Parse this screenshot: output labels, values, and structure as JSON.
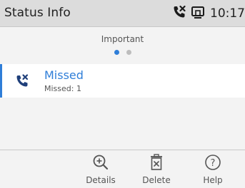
{
  "titlebar": {
    "title": "Status Info",
    "time": "10:17",
    "status_icons": [
      "missed-call-icon",
      "screen-icon"
    ]
  },
  "page": {
    "label": "Important",
    "page_count": 2,
    "active_page": 1
  },
  "items": [
    {
      "icon": "missed-call-icon",
      "title": "Missed",
      "subtitle": "Missed: 1"
    }
  ],
  "softkeys": {
    "details": {
      "label": "Details",
      "icon": "zoom-in-icon"
    },
    "delete": {
      "label": "Delete",
      "icon": "trash-icon"
    },
    "help": {
      "label": "Help",
      "icon": "question-icon"
    }
  },
  "colors": {
    "accent": "#2f7ed8",
    "titlebar_bg": "#dcdcdc",
    "background": "#f3f3f3"
  }
}
